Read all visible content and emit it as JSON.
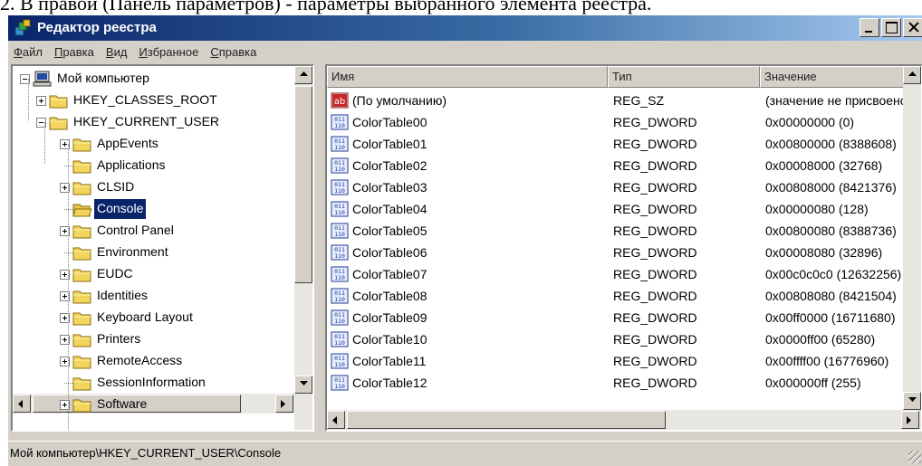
{
  "page_caption": "2. В правой (Панель параметров) - параметры выбранного элемента реестра.",
  "window": {
    "title": "Редактор реестра",
    "controls": {
      "minimize": "minimize-button",
      "maximize": "maximize-button",
      "close": "close-button"
    }
  },
  "menu": [
    {
      "label": "Файл",
      "hot": "Ф",
      "rest": "айл"
    },
    {
      "label": "Правка",
      "hot": "П",
      "rest": "равка"
    },
    {
      "label": "Вид",
      "hot": "В",
      "rest": "ид"
    },
    {
      "label": "Избранное",
      "hot": "И",
      "rest": "збранное"
    },
    {
      "label": "Справка",
      "hot": "С",
      "rest": "правка"
    }
  ],
  "tree": {
    "items": [
      {
        "label": "Мой компьютер",
        "icon": "computer-icon",
        "expander": "minus",
        "level": 0
      },
      {
        "label": "HKEY_CLASSES_ROOT",
        "icon": "folder-icon",
        "expander": "plus",
        "level": 1
      },
      {
        "label": "HKEY_CURRENT_USER",
        "icon": "folder-icon",
        "expander": "minus",
        "level": 1
      },
      {
        "label": "AppEvents",
        "icon": "folder-icon",
        "expander": "plus",
        "level": 2
      },
      {
        "label": "Applications",
        "icon": "folder-icon",
        "expander": "none",
        "level": 2
      },
      {
        "label": "CLSID",
        "icon": "folder-icon",
        "expander": "plus",
        "level": 2
      },
      {
        "label": "Console",
        "icon": "open-folder-icon",
        "expander": "none",
        "level": 2,
        "selected": true
      },
      {
        "label": "Control Panel",
        "icon": "folder-icon",
        "expander": "plus",
        "level": 2
      },
      {
        "label": "Environment",
        "icon": "folder-icon",
        "expander": "none",
        "level": 2
      },
      {
        "label": "EUDC",
        "icon": "folder-icon",
        "expander": "plus",
        "level": 2
      },
      {
        "label": "Identities",
        "icon": "folder-icon",
        "expander": "plus",
        "level": 2
      },
      {
        "label": "Keyboard Layout",
        "icon": "folder-icon",
        "expander": "plus",
        "level": 2
      },
      {
        "label": "Printers",
        "icon": "folder-icon",
        "expander": "plus",
        "level": 2
      },
      {
        "label": "RemoteAccess",
        "icon": "folder-icon",
        "expander": "plus",
        "level": 2
      },
      {
        "label": "SessionInformation",
        "icon": "folder-icon",
        "expander": "none",
        "level": 2
      },
      {
        "label": "Software",
        "icon": "folder-icon",
        "expander": "plus",
        "level": 2
      }
    ]
  },
  "list": {
    "columns": [
      "Имя",
      "Тип",
      "Значение"
    ],
    "rows": [
      {
        "name": "(По умолчанию)",
        "type": "REG_SZ",
        "value": "(значение не присвоено)",
        "icon": "string-value-icon"
      },
      {
        "name": "ColorTable00",
        "type": "REG_DWORD",
        "value": "0x00000000 (0)",
        "icon": "binary-value-icon"
      },
      {
        "name": "ColorTable01",
        "type": "REG_DWORD",
        "value": "0x00800000 (8388608)",
        "icon": "binary-value-icon"
      },
      {
        "name": "ColorTable02",
        "type": "REG_DWORD",
        "value": "0x00008000 (32768)",
        "icon": "binary-value-icon"
      },
      {
        "name": "ColorTable03",
        "type": "REG_DWORD",
        "value": "0x00808000 (8421376)",
        "icon": "binary-value-icon"
      },
      {
        "name": "ColorTable04",
        "type": "REG_DWORD",
        "value": "0x00000080 (128)",
        "icon": "binary-value-icon"
      },
      {
        "name": "ColorTable05",
        "type": "REG_DWORD",
        "value": "0x00800080 (8388736)",
        "icon": "binary-value-icon"
      },
      {
        "name": "ColorTable06",
        "type": "REG_DWORD",
        "value": "0x00008080 (32896)",
        "icon": "binary-value-icon"
      },
      {
        "name": "ColorTable07",
        "type": "REG_DWORD",
        "value": "0x00c0c0c0 (12632256)",
        "icon": "binary-value-icon"
      },
      {
        "name": "ColorTable08",
        "type": "REG_DWORD",
        "value": "0x00808080 (8421504)",
        "icon": "binary-value-icon"
      },
      {
        "name": "ColorTable09",
        "type": "REG_DWORD",
        "value": "0x00ff0000 (16711680)",
        "icon": "binary-value-icon"
      },
      {
        "name": "ColorTable10",
        "type": "REG_DWORD",
        "value": "0x0000ff00 (65280)",
        "icon": "binary-value-icon"
      },
      {
        "name": "ColorTable11",
        "type": "REG_DWORD",
        "value": "0x00ffff00 (16776960)",
        "icon": "binary-value-icon"
      },
      {
        "name": "ColorTable12",
        "type": "REG_DWORD",
        "value": "0x000000ff (255)",
        "icon": "binary-value-icon"
      }
    ]
  },
  "status": {
    "path": "Мой компьютер\\HKEY_CURRENT_USER\\Console"
  },
  "colors": {
    "title_start": "#0a246a",
    "title_end": "#a6caf0",
    "selection": "#0a246a",
    "face": "#d4d0c8",
    "folder": "#f3d45d"
  }
}
